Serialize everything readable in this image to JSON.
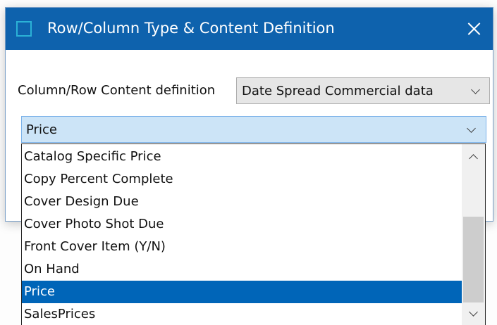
{
  "dialog": {
    "title": "Row/Column Type & Content Definition",
    "accent_color": "#0e62ad"
  },
  "content_definition": {
    "label": "Column/Row Content definition",
    "selected": "Date Spread Commercial data"
  },
  "field_select": {
    "selected": "Price",
    "options": [
      "Catalog Specific Price",
      "Copy Percent Complete",
      "Cover Design Due",
      "Cover Photo Shot Due",
      "Front Cover Item (Y/N)",
      "On Hand",
      "Price",
      "SalesPrices"
    ],
    "selected_index": 6,
    "highlight_color": "#0065b8"
  },
  "icons": {
    "app": "window-icon",
    "close": "close-icon",
    "dropdown": "chevron-down-icon",
    "scroll_up": "chevron-up-icon",
    "scroll_down": "chevron-down-icon"
  }
}
